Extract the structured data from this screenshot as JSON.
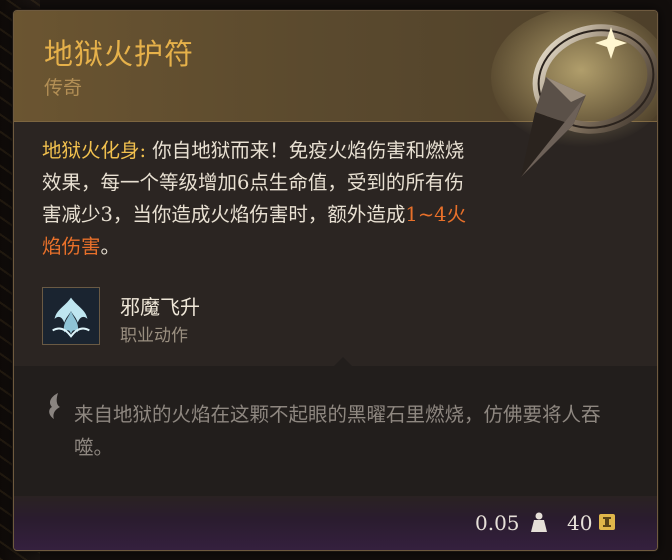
{
  "item": {
    "name": "地狱火护符",
    "rarity": "传奇"
  },
  "passive": {
    "name": "地狱火化身:",
    "text_1": " 你自地狱而来！免疫火焰伤害和",
    "keyword": "燃烧",
    "text_2": "效果，每一个等级增加6点生命值，受到的所有伤害减少3，当你造成火焰伤害时，额外造成",
    "damage": "1~4火焰伤害",
    "text_3": "。"
  },
  "action": {
    "name": "邪魔飞升",
    "type": "职业动作",
    "icon": "infernal-ascension-icon"
  },
  "flavor_text": "来自地狱的火焰在这颗不起眼的黑曜石里燃烧，仿佛要将人吞噬。",
  "footer": {
    "weight": "0.05",
    "weight_icon": "weight-icon",
    "price": "40",
    "price_icon": "gold-coin-icon"
  },
  "colors": {
    "title": "#e6b14a",
    "passive_name": "#f1c04e",
    "damage": "#e8702a",
    "flavor": "#8e8780"
  }
}
